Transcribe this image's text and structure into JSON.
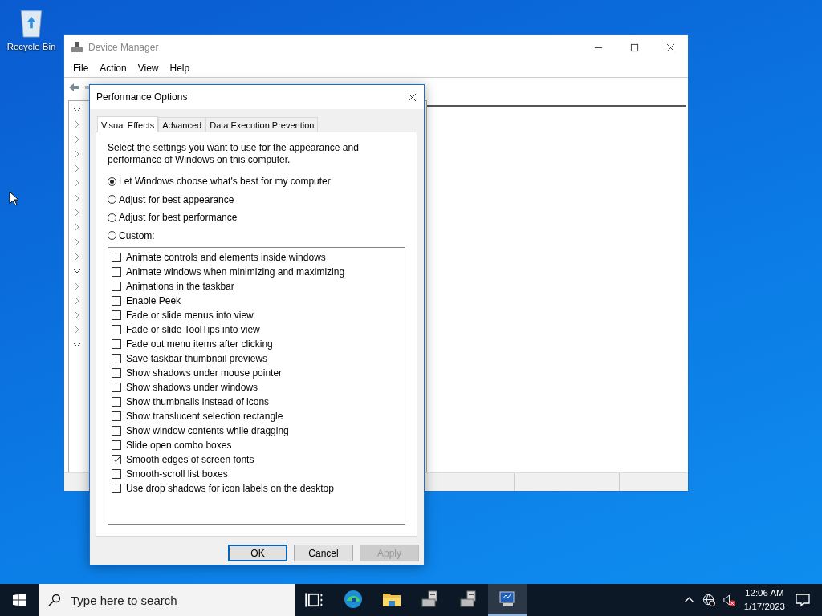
{
  "desktop": {
    "icons": [
      {
        "label": "Recycle Bin"
      }
    ]
  },
  "device_manager": {
    "title": "Device Manager",
    "menu": [
      "File",
      "Action",
      "View",
      "Help"
    ]
  },
  "dialog": {
    "title": "Performance Options",
    "tabs": [
      {
        "label": "Visual Effects",
        "selected": true
      },
      {
        "label": "Advanced",
        "selected": false
      },
      {
        "label": "Data Execution Prevention",
        "selected": false
      }
    ],
    "description": "Select the settings you want to use for the appearance and performance of Windows on this computer.",
    "options": [
      {
        "label": "Let Windows choose what's best for my computer",
        "selected": true
      },
      {
        "label": "Adjust for best appearance",
        "selected": false
      },
      {
        "label": "Adjust for best performance",
        "selected": false
      },
      {
        "label": "Custom:",
        "selected": false
      }
    ],
    "effects": [
      {
        "label": "Animate controls and elements inside windows",
        "checked": false
      },
      {
        "label": "Animate windows when minimizing and maximizing",
        "checked": false
      },
      {
        "label": "Animations in the taskbar",
        "checked": false
      },
      {
        "label": "Enable Peek",
        "checked": false
      },
      {
        "label": "Fade or slide menus into view",
        "checked": false
      },
      {
        "label": "Fade or slide ToolTips into view",
        "checked": false
      },
      {
        "label": "Fade out menu items after clicking",
        "checked": false
      },
      {
        "label": "Save taskbar thumbnail previews",
        "checked": false
      },
      {
        "label": "Show shadows under mouse pointer",
        "checked": false
      },
      {
        "label": "Show shadows under windows",
        "checked": false
      },
      {
        "label": "Show thumbnails instead of icons",
        "checked": false
      },
      {
        "label": "Show translucent selection rectangle",
        "checked": false
      },
      {
        "label": "Show window contents while dragging",
        "checked": false
      },
      {
        "label": "Slide open combo boxes",
        "checked": false
      },
      {
        "label": "Smooth edges of screen fonts",
        "checked": true
      },
      {
        "label": "Smooth-scroll list boxes",
        "checked": false
      },
      {
        "label": "Use drop shadows for icon labels on the desktop",
        "checked": false
      }
    ],
    "buttons": [
      {
        "label": "OK",
        "default": true,
        "disabled": false
      },
      {
        "label": "Cancel",
        "default": false,
        "disabled": false
      },
      {
        "label": "Apply",
        "default": false,
        "disabled": true
      }
    ]
  },
  "taskbar": {
    "search": {
      "placeholder": "Type here to search"
    },
    "apps": [
      {
        "kind": "edge",
        "selected": false
      },
      {
        "kind": "folder",
        "selected": false
      },
      {
        "kind": "device",
        "selected": false
      },
      {
        "kind": "device",
        "selected": false
      },
      {
        "kind": "monitor",
        "selected": true
      }
    ],
    "time": "12:06 AM",
    "date": "1/17/2023"
  }
}
